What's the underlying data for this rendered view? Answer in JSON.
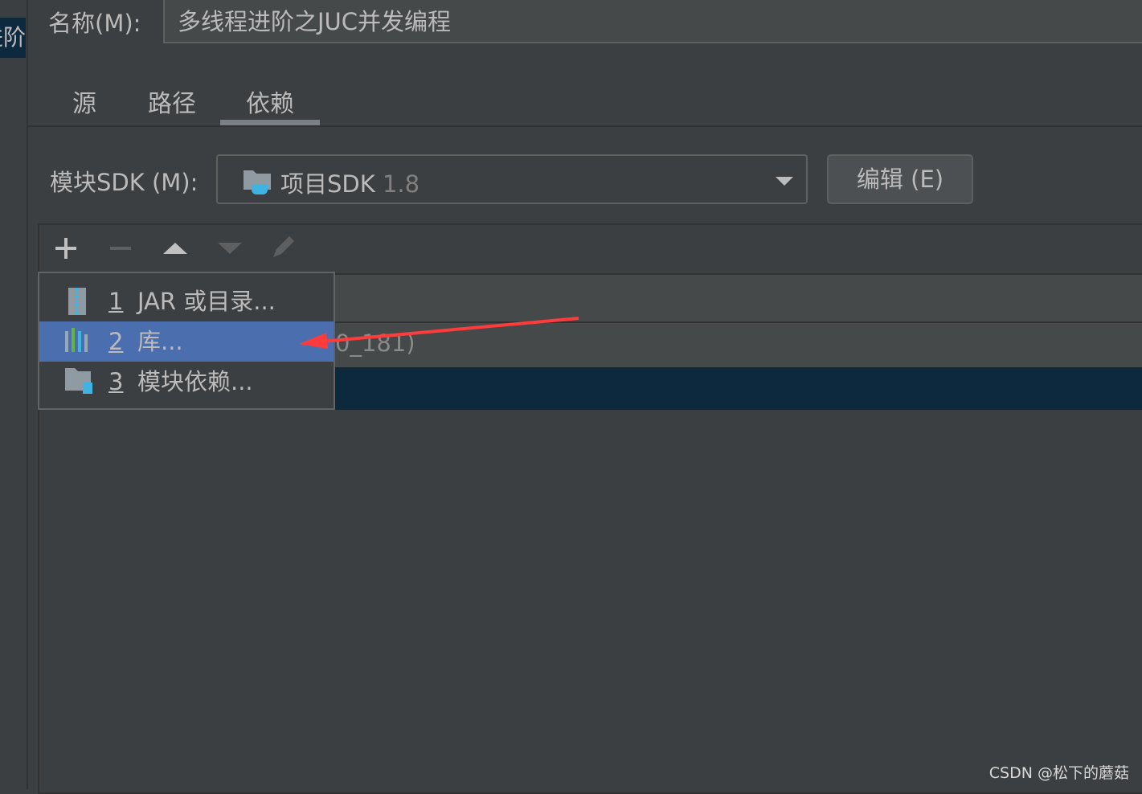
{
  "left_panel": {
    "selected_item_text": "多线程进阶"
  },
  "name": {
    "label": "名称(M):",
    "value": "多线程进阶之JUC并发编程"
  },
  "tabs": [
    {
      "label": "源"
    },
    {
      "label": "路径"
    },
    {
      "label": "依赖",
      "active": true
    }
  ],
  "sdk": {
    "label": "模块SDK (M):",
    "value": "项目SDK",
    "version": "1.8",
    "edit_button": "编辑 (E)"
  },
  "toolbar": {
    "icons": [
      "plus-icon",
      "minus-icon",
      "move-up-icon",
      "move-down-icon",
      "edit-icon"
    ]
  },
  "table": {
    "rows": [
      {
        "text": "0_181)"
      },
      {
        "text": ""
      }
    ]
  },
  "popup_menu": {
    "items": [
      {
        "number": "1",
        "label": "JAR 或目录...",
        "icon": "jar-icon"
      },
      {
        "number": "2",
        "label": "库...",
        "icon": "library-icon",
        "selected": true
      },
      {
        "number": "3",
        "label": "模块依赖...",
        "icon": "module-icon"
      }
    ]
  },
  "annotation": {
    "arrow_color": "#ff3b3b"
  },
  "watermark": "CSDN @松下的蘑菇",
  "colors": {
    "selection": "#4b6eaf",
    "row_selected": "#0d293e",
    "background": "#3c3f41"
  }
}
